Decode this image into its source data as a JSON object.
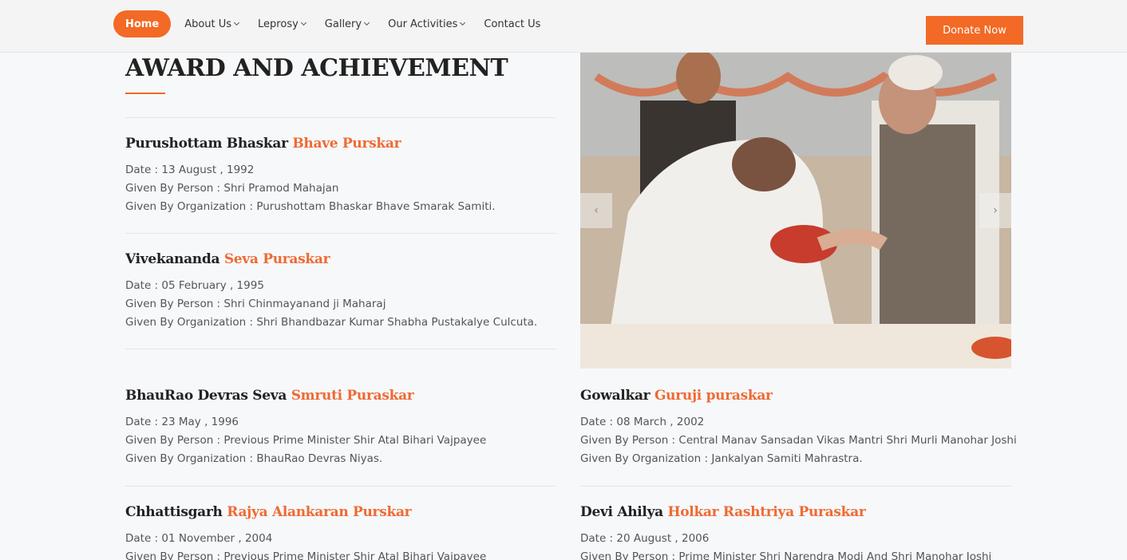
{
  "nav": {
    "items": [
      "Home",
      "About Us",
      "Leprosy",
      "Gallery",
      "Our Activities",
      "Contact Us"
    ],
    "donate": "Donate Now"
  },
  "page": {
    "title": "AWARD AND ACHIEVEMENT"
  },
  "awards": [
    {
      "title_a": "Purushottam Bhaskar",
      "title_b": "Bhave Purskar",
      "date": "Date : 13 August , 1992",
      "person": "Given By Person : Shri Pramod Mahajan",
      "org": "Given By Organization : Purushottam Bhaskar Bhave Smarak Samiti."
    },
    {
      "title_a": "Vivekananda",
      "title_b": "Seva Puraskar",
      "date": "Date : 05 February , 1995",
      "person": "Given By Person : Shri Chinmayanand ji Maharaj",
      "org": "Given By Organization : Shri Bhandbazar Kumar Shabha Pustakalye Culcuta."
    },
    {
      "title_a": "BhauRao Devras Seva",
      "title_b": "Smruti Puraskar",
      "date": "Date : 23 May , 1996",
      "person": "Given By Person : Previous Prime Minister Shir Atal Bihari Vajpayee",
      "org": "Given By Organization : BhauRao Devras Niyas."
    },
    {
      "title_a": "Gowalkar",
      "title_b": "Guruji puraskar",
      "date": "Date : 08 March , 2002",
      "person": "Given By Person : Central Manav Sansadan Vikas Mantri Shri Murli Manohar Joshi",
      "org": "Given By Organization : Jankalyan Samiti Mahrastra."
    },
    {
      "title_a": "Chhattisgarh",
      "title_b": "Rajya Alankaran Purskar",
      "date": "Date : 01 November , 2004",
      "person": "Given By Person : Previous Prime Minister Shir Atal Bihari Vajpayee",
      "org": ""
    },
    {
      "title_a": "Devi Ahilya",
      "title_b": "Holkar Rashtriya Puraskar",
      "date": "Date : 20 August , 2006",
      "person": "Given By Person : Prime Minister Shri Narendra Modi And Shri Manohar Joshi",
      "org": ""
    }
  ],
  "carousel": {
    "prev": "‹",
    "next": "›"
  },
  "colors": {
    "accent": "#f26a25",
    "highlight": "#ef6a33"
  }
}
